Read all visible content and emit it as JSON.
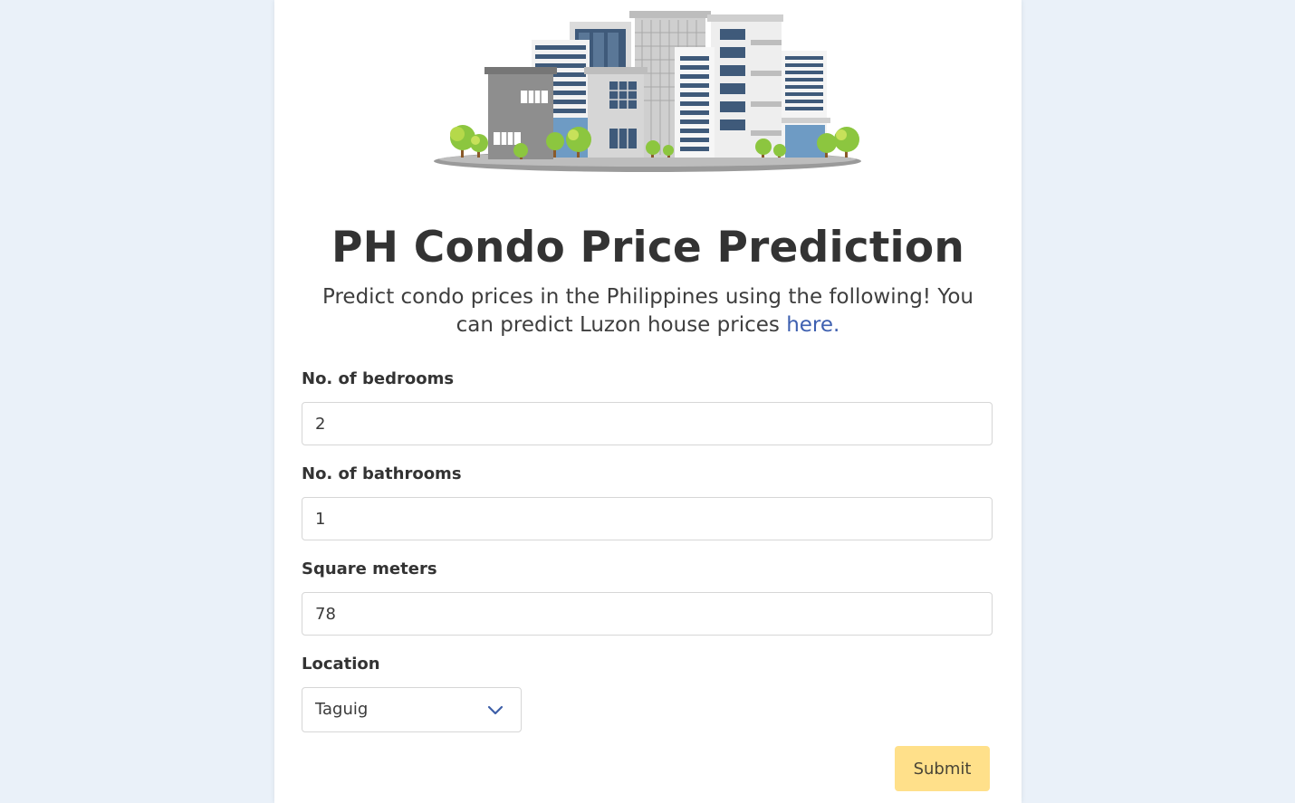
{
  "header": {
    "image_name": "condo-buildings-illustration",
    "title": "PH Condo Price Prediction",
    "subtitle_text": "Predict condo prices in the Philippines using the following! You can predict Luzon house prices ",
    "subtitle_link": "here."
  },
  "form": {
    "bedrooms": {
      "label": "No. of bedrooms",
      "value": "2"
    },
    "bathrooms": {
      "label": "No. of bathrooms",
      "value": "1"
    },
    "sqm": {
      "label": "Square meters",
      "value": "78"
    },
    "location": {
      "label": "Location",
      "selected": "Taguig",
      "icon": "chevron-down-icon"
    },
    "submit_label": "Submit"
  },
  "colors": {
    "page_background": "#eaf1f9",
    "link": "#3e60b0",
    "submit_button": "#ffe08a"
  }
}
